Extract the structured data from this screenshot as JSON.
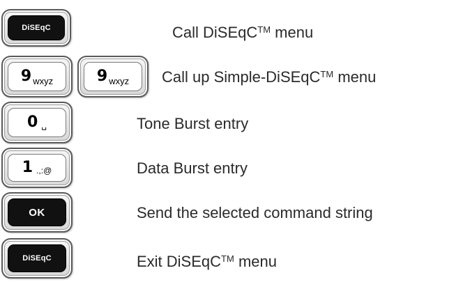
{
  "rows": [
    {
      "keys": [
        {
          "type": "dark",
          "text": "DiSEqC"
        }
      ],
      "label": {
        "before": "Call DiSEqC",
        "tm": "TM",
        "after": " menu"
      }
    },
    {
      "keys": [
        {
          "type": "digit",
          "digit": "9",
          "sub": "wxyz"
        },
        {
          "type": "digit",
          "digit": "9",
          "sub": "wxyz"
        }
      ],
      "label": {
        "before": "Call up Simple-DiSEqC",
        "tm": "TM",
        "after": " menu"
      }
    },
    {
      "keys": [
        {
          "type": "digit",
          "digit": "0",
          "sub": "␣"
        }
      ],
      "label": {
        "before": "Tone Burst entry",
        "tm": "",
        "after": ""
      }
    },
    {
      "keys": [
        {
          "type": "digit",
          "digit": "1",
          "sub": ".,:@"
        }
      ],
      "label": {
        "before": "Data Burst entry",
        "tm": "",
        "after": ""
      }
    },
    {
      "keys": [
        {
          "type": "dark",
          "text": "OK"
        }
      ],
      "label": {
        "before": "Send the selected command string",
        "tm": "",
        "after": ""
      }
    },
    {
      "keys": [
        {
          "type": "dark",
          "text": "DiSEqC"
        }
      ],
      "label": {
        "before": "Exit DiSEqC",
        "tm": "TM",
        "after": " menu"
      }
    }
  ]
}
